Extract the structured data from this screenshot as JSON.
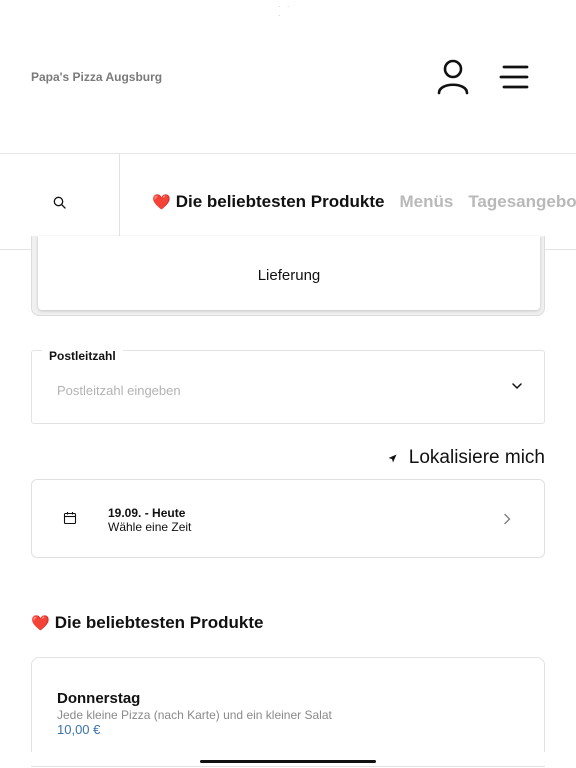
{
  "status": {
    "dots": "· · ·"
  },
  "header": {
    "brand": "Papa's Pizza Augsburg",
    "user_icon": "user-icon",
    "menu_icon": "hamburger-menu-icon"
  },
  "category_bar": {
    "search_icon": "search-icon",
    "tabs": [
      {
        "label": "Die beliebtesten Produkte",
        "emoji": "❤️",
        "active": true
      },
      {
        "label": "Menüs",
        "active": false
      },
      {
        "label": "Tagesangebote",
        "active": false
      }
    ]
  },
  "delivery": {
    "label": "Lieferung"
  },
  "zip": {
    "label": "Postleitzahl",
    "placeholder": "Postleitzahl eingeben",
    "chevron_icon": "chevron-down-icon"
  },
  "locate": {
    "label": "Lokalisiere mich",
    "icon": "location-arrow-icon"
  },
  "time": {
    "date": "19.09. - Heute",
    "prompt": "Wähle eine Zeit",
    "icon": "calendar-icon",
    "chevron_icon": "chevron-right-icon"
  },
  "section": {
    "emoji": "❤️",
    "title": "Die beliebtesten Produkte"
  },
  "products": [
    {
      "name": "Donnerstag",
      "description": "Jede kleine Pizza (nach Karte) und ein kleiner Salat",
      "price": "10,00 €"
    }
  ],
  "colors": {
    "accent_price": "#3c73a8",
    "heart": "#e0202a",
    "inactive_tab": "#b9b9b9"
  }
}
